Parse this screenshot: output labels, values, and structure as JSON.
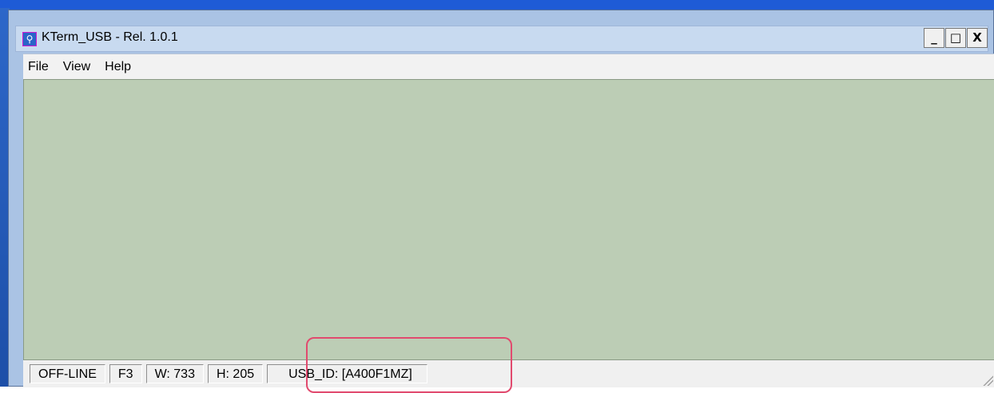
{
  "window": {
    "title": "KTerm_USB - Rel. 1.0.1",
    "icon": "usb-icon",
    "controls": {
      "minimize": "_",
      "maximize": "□",
      "close": "X"
    }
  },
  "menu": {
    "items": [
      "File",
      "View",
      "Help"
    ]
  },
  "status": {
    "connection": "OFF-LINE",
    "font": "F3",
    "width": "W:  733",
    "height": "H:  205",
    "usb_id": "USB_ID: [A400F1MZ]"
  },
  "colors": {
    "terminal_bg": "#bccdb5",
    "highlight": "#e14a6e"
  }
}
